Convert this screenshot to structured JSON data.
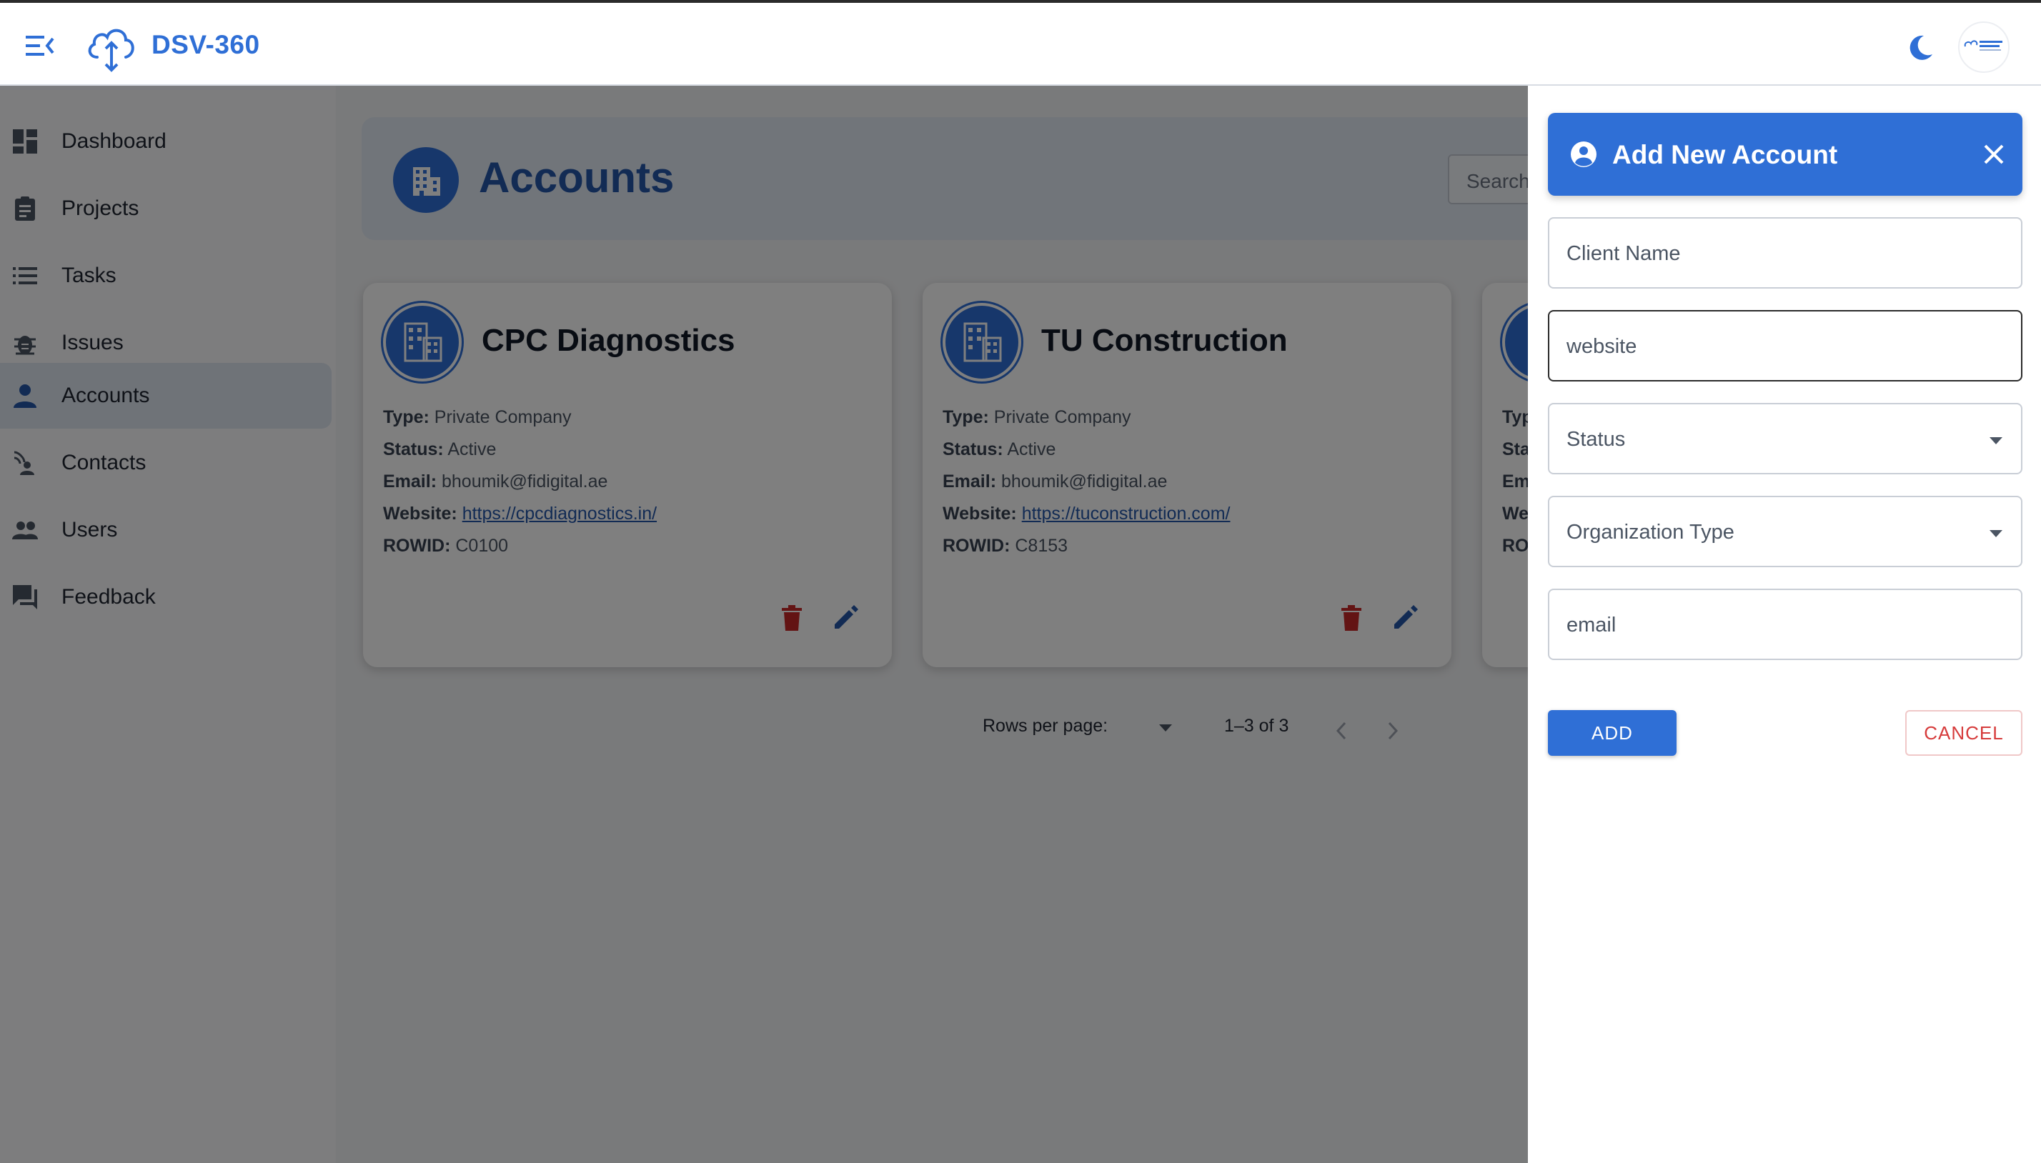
{
  "app": {
    "brand": "DSV-360"
  },
  "colors": {
    "accent": "#2f6fd6",
    "delete": "#c62828",
    "cancel": "#d63b3b"
  },
  "sidebar": {
    "items": [
      {
        "label": "Dashboard",
        "icon": "dashboard-icon"
      },
      {
        "label": "Projects",
        "icon": "clipboard-icon"
      },
      {
        "label": "Tasks",
        "icon": "list-icon"
      },
      {
        "label": "Issues",
        "icon": "bug-icon"
      },
      {
        "label": "Accounts",
        "icon": "person-icon",
        "active": true
      },
      {
        "label": "Contacts",
        "icon": "contacts-icon"
      },
      {
        "label": "Users",
        "icon": "group-icon"
      },
      {
        "label": "Feedback",
        "icon": "feedback-icon"
      }
    ]
  },
  "main": {
    "title": "Accounts",
    "search_placeholder": "Search",
    "cards": [
      {
        "name": "CPC Diagnostics",
        "type_label": "Type:",
        "type": "Private Company",
        "status_label": "Status:",
        "status": "Active",
        "email_label": "Email:",
        "email": "bhoumik@fidigital.ae",
        "website_label": "Website:",
        "website": "https://cpcdiagnostics.in/",
        "rowid_label": "ROWID:",
        "rowid": "C0100"
      },
      {
        "name": "TU Construction",
        "type_label": "Type:",
        "type": "Private Company",
        "status_label": "Status:",
        "status": "Active",
        "email_label": "Email:",
        "email": "bhoumik@fidigital.ae",
        "website_label": "Website:",
        "website": "https://tuconstruction.com/",
        "rowid_label": "ROWID:",
        "rowid": "C8153"
      },
      {
        "name": "",
        "type_label": "Typ",
        "type": "",
        "status_label": "Sta",
        "status": "",
        "email_label": "Em",
        "email": "",
        "website_label": "We",
        "website": "",
        "rowid_label": "RO",
        "rowid": ""
      }
    ],
    "pagination": {
      "rows_label": "Rows per page:",
      "range": "1–3 of 3"
    }
  },
  "drawer": {
    "title": "Add New Account",
    "fields": {
      "client_name": "Client Name",
      "website": "website",
      "status": "Status",
      "organization_type": "Organization Type",
      "email": "email"
    },
    "add_label": "ADD",
    "cancel_label": "CANCEL"
  }
}
